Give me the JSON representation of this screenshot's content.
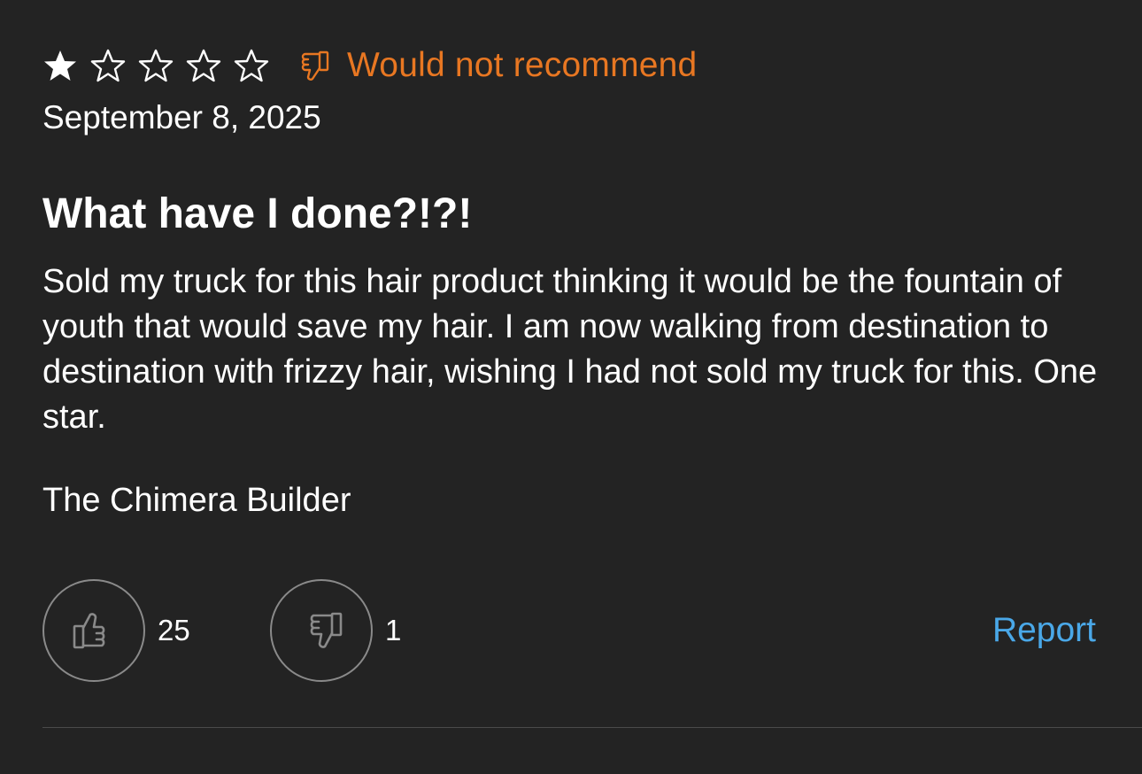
{
  "review": {
    "rating": 1,
    "max_rating": 5,
    "recommendation": "Would not recommend",
    "date": "September 8, 2025",
    "title": "What have I done?!?!",
    "body": "Sold my truck for this hair product thinking it would be the fountain of youth that would save my hair. I am now walking from destination to destination with frizzy hair, wishing I had not sold my truck for this. One star.",
    "author": "The Chimera Builder"
  },
  "votes": {
    "helpful_count": "25",
    "unhelpful_count": "1",
    "helpful_icon": "thumbs-up-icon",
    "unhelpful_icon": "thumbs-down-icon"
  },
  "actions": {
    "report_label": "Report"
  },
  "colors": {
    "background": "#232323",
    "recommendation": "#e87722",
    "link": "#4aa8e8",
    "icon_outline": "#8a8a8a"
  }
}
